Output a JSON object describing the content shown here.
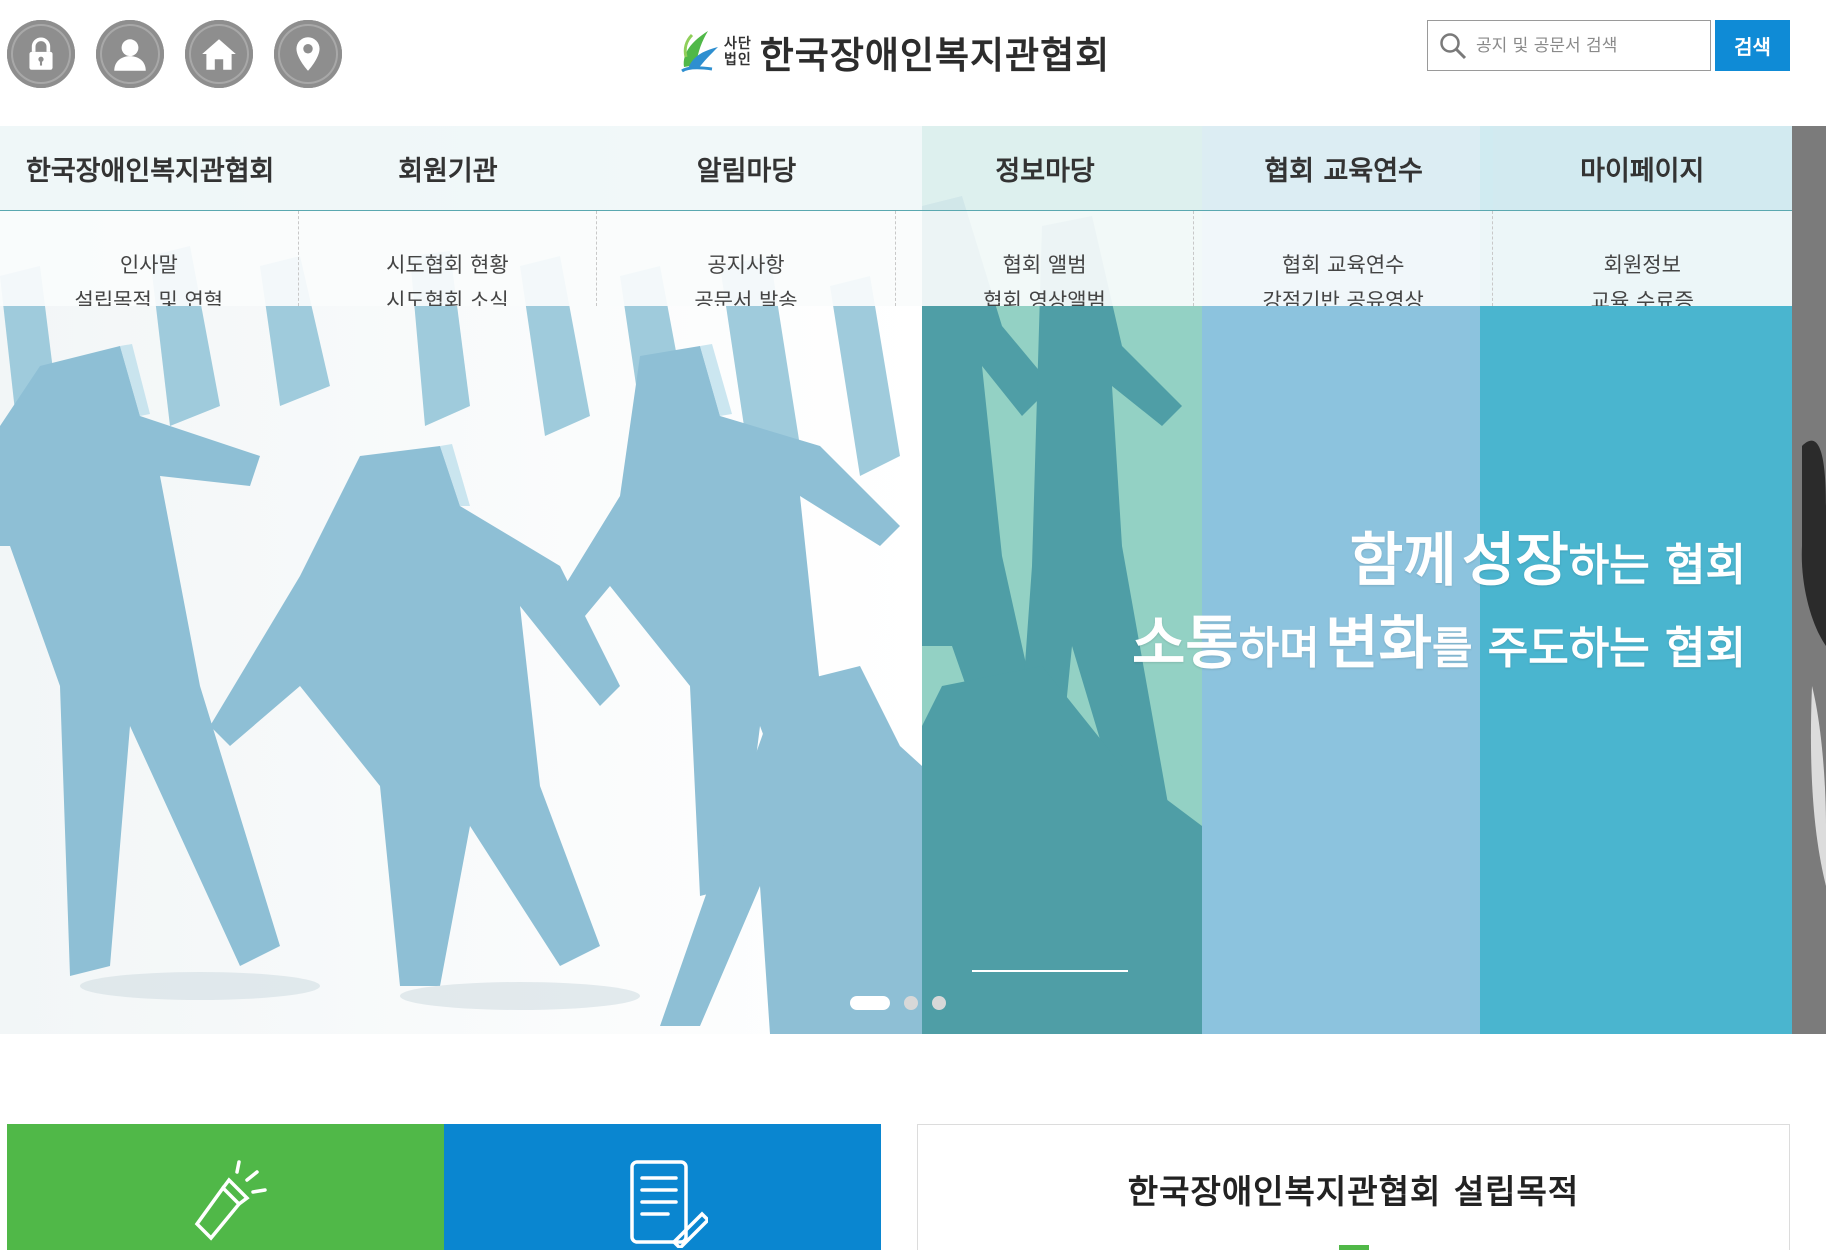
{
  "header": {
    "logo_sub_top": "사단",
    "logo_sub_bottom": "법인",
    "logo_text": "한국장애인복지관협회",
    "utility_icons": [
      "lock-icon",
      "user-icon",
      "home-icon",
      "location-pin-icon"
    ],
    "search": {
      "placeholder": "공지 및 공문서 검색",
      "button_label": "검색"
    }
  },
  "nav": {
    "items": [
      {
        "label": "한국장애인복지관협회",
        "subs": [
          "인사말",
          "설립목적 및 연혁"
        ]
      },
      {
        "label": "회원기관",
        "subs": [
          "시도협회 현황",
          "시도협회 소식"
        ]
      },
      {
        "label": "알림마당",
        "subs": [
          "공지사항",
          "공문서 발송"
        ]
      },
      {
        "label": "정보마당",
        "subs": [
          "협회 앨범",
          "협회 영상앨범"
        ]
      },
      {
        "label": "협회 교육연수",
        "subs": [
          "협회 교육연수",
          "강점기반 공유영상"
        ]
      },
      {
        "label": "마이페이지",
        "subs": [
          "회원정보",
          "교육 수료증"
        ]
      }
    ]
  },
  "hero": {
    "line1": {
      "strong1": "함께",
      "strong2": "성장",
      "rest": "하는 협회"
    },
    "line2": {
      "strong1": "소통",
      "mid1": "하며",
      "strong2": "변화",
      "rest": "를 주도하는 협회"
    },
    "slides_total": 3,
    "active_slide": 1
  },
  "bottom": {
    "quick_tiles": [
      {
        "icon": "flashlight-icon",
        "color": "#50b848"
      },
      {
        "icon": "document-edit-icon",
        "color": "#0a86d0"
      }
    ],
    "purpose_title": "한국장애인복지관협회 설립목적"
  },
  "colors": {
    "accent_blue": "#0f8bd6",
    "accent_green": "#50b848",
    "panel_teal": "#93d1c4",
    "panel_sky": "#8cc3de",
    "panel_cyan": "#4ab5cf"
  }
}
